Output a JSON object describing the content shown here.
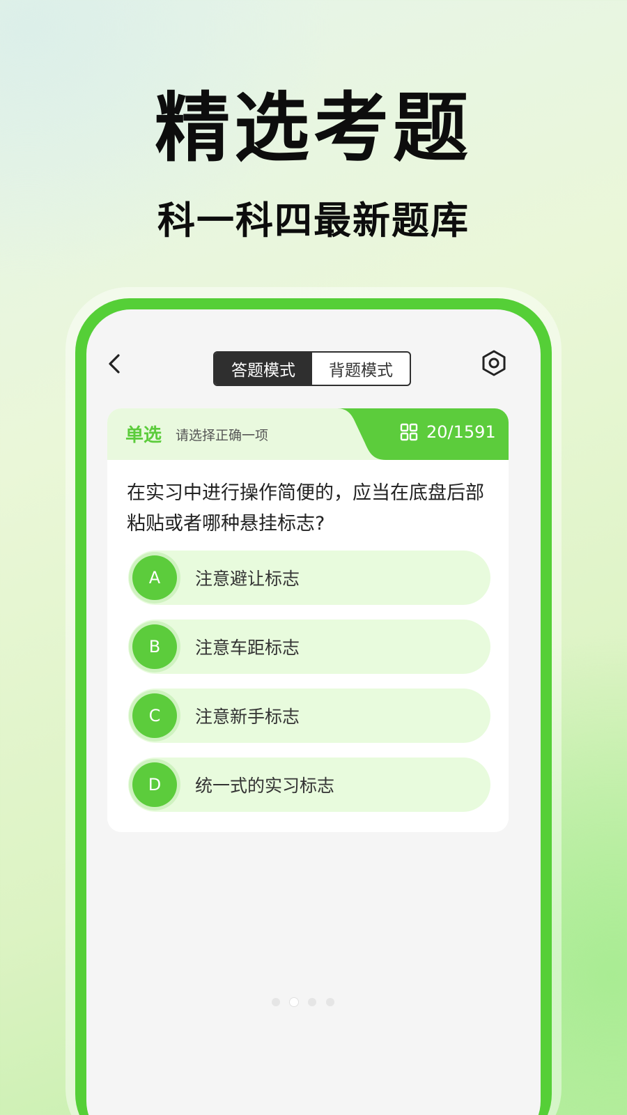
{
  "hero": {
    "title": "精选考题",
    "subtitle": "科一科四最新题库"
  },
  "topbar": {
    "back_icon": "chevron-left-icon",
    "modes": [
      "答题模式",
      "背题模式"
    ],
    "active_mode": "答题模式",
    "settings_icon": "hexagon-settings-icon"
  },
  "question_card": {
    "type_label": "单选",
    "hint": "请选择正确一项",
    "progress_icon": "grid-icon",
    "progress": "20/1591",
    "question": "在实习中进行操作简便的，应当在底盘后部粘贴或者哪种悬挂标志?",
    "options": [
      {
        "letter": "A",
        "text": "注意避让标志"
      },
      {
        "letter": "B",
        "text": "注意车距标志"
      },
      {
        "letter": "C",
        "text": "注意新手标志"
      },
      {
        "letter": "D",
        "text": "统一式的实习标志"
      }
    ]
  },
  "pager": {
    "count": 4,
    "active_index": 1
  },
  "colors": {
    "accent": "#5ccc3c",
    "frame": "#55cf37",
    "option_bg": "#e8fbdd",
    "toggle_dark": "#2f2f2f"
  }
}
